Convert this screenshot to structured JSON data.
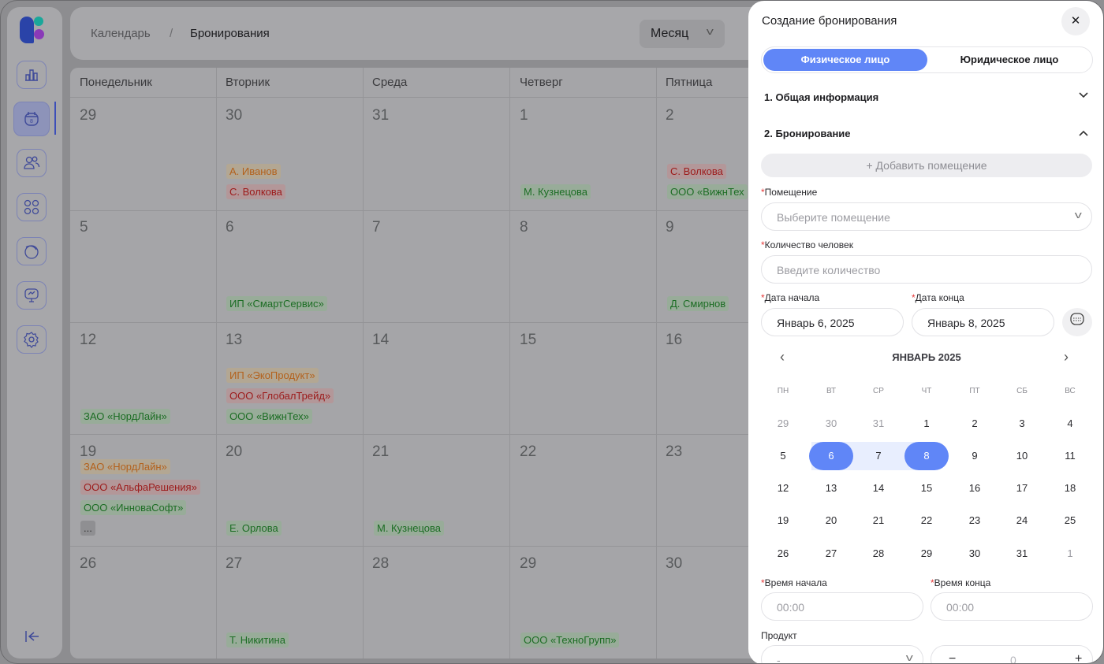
{
  "breadcrumb": {
    "first": "Календарь",
    "separator": "/",
    "current": "Бронирования"
  },
  "view_select": {
    "value": "Месяц"
  },
  "calendar": {
    "weekdays": [
      "Понедельник",
      "Вторник",
      "Среда",
      "Четверг",
      "Пятница"
    ],
    "weeks": [
      {
        "days": [
          "29",
          "30",
          "31",
          "1",
          "2"
        ]
      },
      {
        "days": [
          "5",
          "6",
          "7",
          "8",
          "9"
        ]
      },
      {
        "days": [
          "12",
          "13",
          "14",
          "15",
          "16"
        ]
      },
      {
        "days": [
          "19",
          "20",
          "21",
          "22",
          "23"
        ]
      },
      {
        "days": [
          "26",
          "27",
          "28",
          "29",
          "30"
        ]
      }
    ],
    "events": {
      "w0_tue_1": "А. Иванов",
      "w0_tue_2": "С. Волкова",
      "w0_thu_1": "М. Кузнецова",
      "w0_fri_1": "С. Волкова",
      "w0_fri_2": "ООО «ВижнТех",
      "w1_tue_1": "ИП «СмартСервис»",
      "w1_fri_1": "Д. Смирнов",
      "w2_mon_1": "ЗАО «НордЛайн»",
      "w2_tue_1": "ИП «ЭкоПродукт»",
      "w2_tue_2": "ООО «ГлобалТрейд»",
      "w2_tue_3": "ООО «ВижнТех»",
      "w3_mon_1": "ЗАО «НордЛайн»",
      "w3_mon_2": "ООО «АльфаРешения»",
      "w3_mon_3": "ООО «ИнноваСофт»",
      "w3_mon_more": "...",
      "w3_tue_1": "Е. Орлова",
      "w3_wed_1": "М. Кузнецова",
      "w4_tue_1": "Т. Никитина",
      "w4_thu_1": "ООО «ТехноГрупп»"
    }
  },
  "drawer": {
    "title": "Создание бронирования",
    "close": "✕",
    "toggle": {
      "individual": "Физическое лицо",
      "legal": "Юридическое лицо"
    },
    "section1": "1. Общая информация",
    "section2": "2. Бронирование",
    "add_room": "+ Добавить помещение",
    "room_label": "Помещение",
    "room_placeholder": "Выберите помещение",
    "people_label": "Количество человек",
    "people_placeholder": "Введите количество",
    "start_date_label": "Дата начала",
    "start_date_value": "Январь 6, 2025",
    "end_date_label": "Дата конца",
    "end_date_value": "Январь 8, 2025",
    "month_title": "ЯНВАРЬ 2025",
    "mini_weekdays": [
      "ПН",
      "ВТ",
      "СР",
      "ЧТ",
      "ПТ",
      "СБ",
      "ВС"
    ],
    "mini_weeks": [
      [
        "29",
        "30",
        "31",
        "1",
        "2",
        "3",
        "4"
      ],
      [
        "5",
        "6",
        "7",
        "8",
        "9",
        "10",
        "11"
      ],
      [
        "12",
        "13",
        "14",
        "15",
        "16",
        "17",
        "18"
      ],
      [
        "19",
        "20",
        "21",
        "22",
        "23",
        "24",
        "25"
      ],
      [
        "26",
        "27",
        "28",
        "29",
        "30",
        "31",
        "1"
      ]
    ],
    "start_time_label": "Время начала",
    "start_time_placeholder": "00:00",
    "end_time_label": "Время конца",
    "end_time_placeholder": "00:00",
    "product_label": "Продукт",
    "product_value": "-",
    "quantity_value": "0",
    "colors": {
      "accent": "#6086f7",
      "range": "#e8eefe",
      "required": "#e63a3a"
    }
  }
}
